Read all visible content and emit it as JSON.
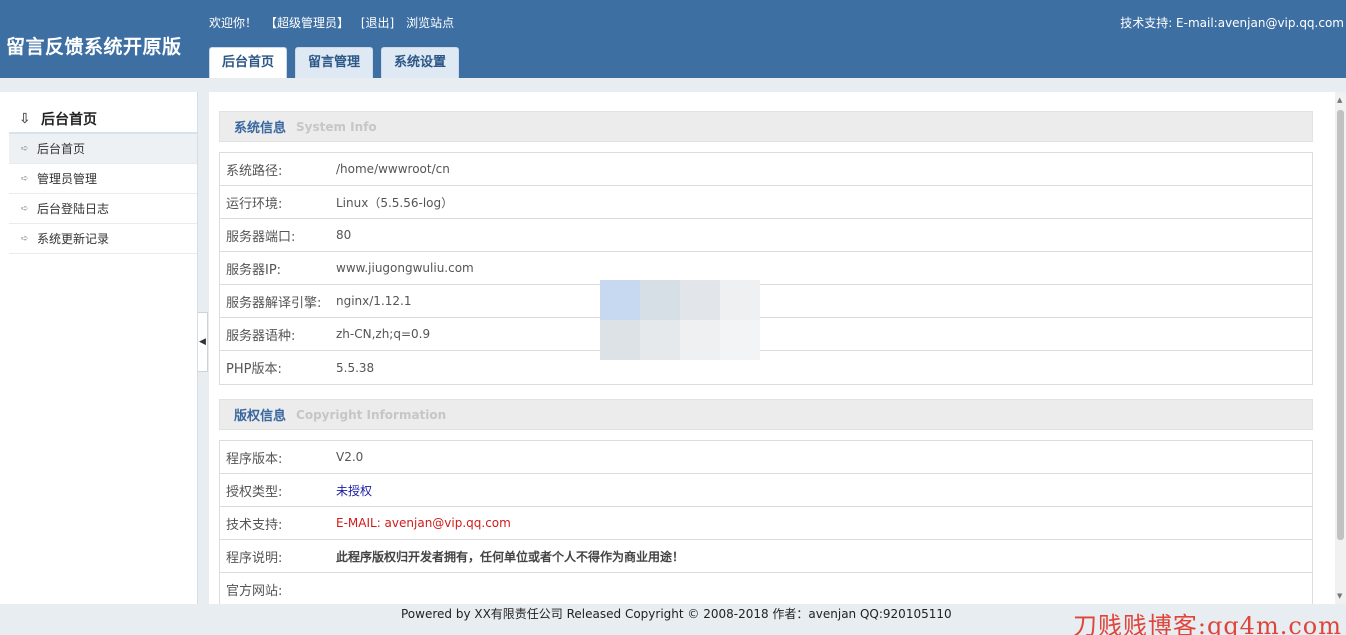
{
  "header": {
    "logo": "留言反馈系统开原版",
    "welcome": "欢迎你！",
    "role": "【超级管理员】",
    "logout": "[退出]",
    "browse": "浏览站点",
    "support": "技术支持: E-mail:avenjan@vip.qq.com"
  },
  "tabs": [
    {
      "label": "后台首页"
    },
    {
      "label": "留言管理"
    },
    {
      "label": "系统设置"
    }
  ],
  "sidebar": {
    "title": "后台首页",
    "items": [
      {
        "label": "后台首页"
      },
      {
        "label": "管理员管理"
      },
      {
        "label": "后台登陆日志"
      },
      {
        "label": "系统更新记录"
      }
    ]
  },
  "system_info": {
    "title_cn": "系统信息",
    "title_en": "System  Info",
    "rows": [
      {
        "label": "系统路径:",
        "value": "/home/wwwroot/cn"
      },
      {
        "label": "运行环境:",
        "value": "Linux（5.5.56-log）"
      },
      {
        "label": "服务器端口:",
        "value": "80"
      },
      {
        "label": "服务器IP:",
        "value": "www.jiugongwuliu.com"
      },
      {
        "label": "服务器解译引擎:",
        "value": "nginx/1.12.1"
      },
      {
        "label": "服务器语种:",
        "value": "zh-CN,zh;q=0.9"
      },
      {
        "label": "PHP版本:",
        "value": "5.5.38"
      }
    ]
  },
  "copyright_info": {
    "title_cn": "版权信息",
    "title_en": "Copyright Information",
    "rows": [
      {
        "label": "程序版本:",
        "value": "V2.0"
      },
      {
        "label": "授权类型:",
        "value": "未授权"
      },
      {
        "label": "技术支持:",
        "value": "E-MAIL: avenjan@vip.qq.com"
      },
      {
        "label": "程序说明:",
        "value": "此程序版权归开发者拥有，任何单位或者个人不得作为商业用途！"
      },
      {
        "label": "官方网站:",
        "value": ""
      }
    ]
  },
  "footer": {
    "powered": "Powered by XX有限责任公司  Released Copyright © 2008-2018 作者：avenjan QQ:920105110",
    "watermark": "刀贱贱博客:qq4m.com"
  },
  "colors": {
    "header_bg": "#3e6fa3",
    "section_title": "#3a67a0",
    "link_blue": "#1a1aa6",
    "support_red": "#d11b1b",
    "watermark_red": "#e0443b"
  }
}
